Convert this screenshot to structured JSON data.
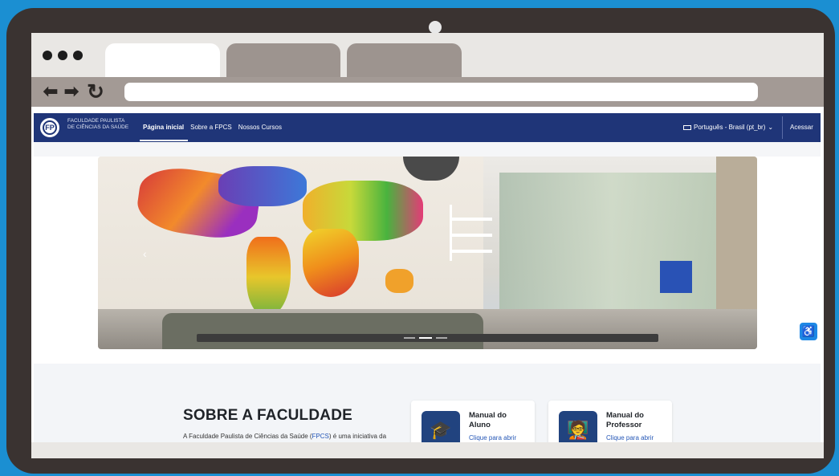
{
  "colors": {
    "background": "#1b8fd2",
    "device": "#3a3331",
    "site_nav": "#1f3578",
    "link": "#2456b6"
  },
  "browser": {
    "window_controls": [
      "dot-icon",
      "dot-icon",
      "dot-icon"
    ],
    "nav_icons": {
      "back": "arrow-left-icon",
      "forward": "arrow-right-icon",
      "reload": "reload-icon"
    },
    "back_glyph": "⬅",
    "forward_glyph": "➡",
    "reload_glyph": "↻",
    "url": ""
  },
  "site": {
    "logo": {
      "line1": "FACULDADE PAULISTA",
      "line2": "DE CIÊNCIAS DA SAÚDE",
      "line3": "",
      "emblem": "FP"
    },
    "menu": [
      {
        "label": "Página inicial",
        "active": true
      },
      {
        "label": "Sobre a FPCS",
        "active": false
      },
      {
        "label": "Nossos Cursos",
        "active": false
      }
    ],
    "language": "Português - Brasil (pt_br)",
    "language_caret": "⌄",
    "login": "Acessar"
  },
  "carousel": {
    "prev_glyph": "‹",
    "indicators": 3,
    "active_indicator": 1
  },
  "accessibility_glyph": "♿",
  "about": {
    "title": "SOBRE A FACULDADE",
    "text_before": "A Faculdade Paulista de Ciências da Saúde (",
    "text_link": "FPCS",
    "text_after": ") é uma iniciativa da",
    "cards": [
      {
        "title": "Manual do Aluno",
        "subtitle": "Clique para abrir",
        "icon": "student-icon",
        "glyph": "🎓"
      },
      {
        "title": "Manual do Professor",
        "subtitle": "Clique para abrir",
        "icon": "teacher-icon",
        "glyph": "🧑‍🏫"
      }
    ]
  }
}
